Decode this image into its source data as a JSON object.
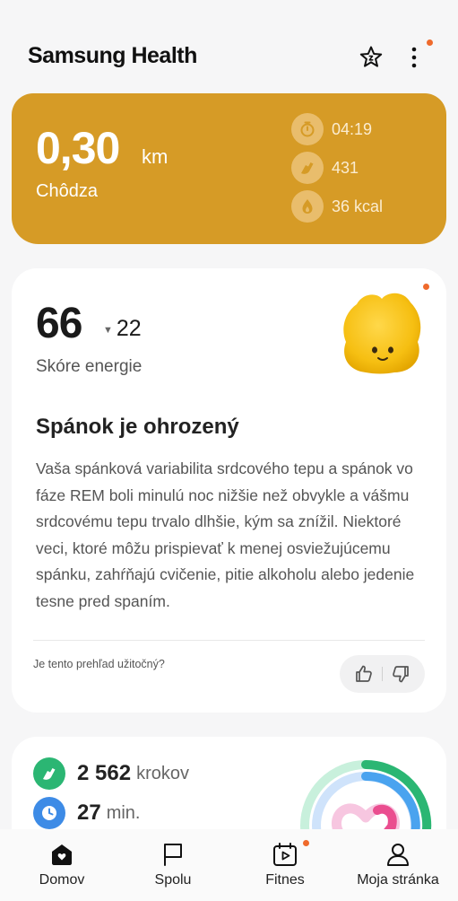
{
  "header": {
    "title": "Samsung Health",
    "star_icon": "star-icon",
    "more_icon": "more-vertical-icon"
  },
  "walk": {
    "distance": "0,30",
    "unit": "km",
    "activity": "Chôdza",
    "stats": [
      {
        "icon": "timer-icon",
        "value": "04:19"
      },
      {
        "icon": "shoe-icon",
        "value": "431"
      },
      {
        "icon": "flame-icon",
        "value": "36 kcal"
      }
    ],
    "color": "#d69b26"
  },
  "energy": {
    "score": "66",
    "delta": "22",
    "label": "Skóre energie",
    "insight_title": "Spánok je ohrozený",
    "insight_body": "Vaša spánková variabilita srdcového tepu a spánok vo fáze REM boli minulú noc nižšie než obvykle a vášmu srdcovému tepu trvalo dlhšie, kým sa znížil. Niektoré veci, ktoré môžu prispievať k menej osviežujúcemu spánku, zahŕňajú cvičenie, pitie alkoholu alebo jedenie tesne pred spaním.",
    "feedback_question": "Je tento prehľad užitočný?"
  },
  "activity": {
    "steps_value": "2 562",
    "steps_unit": "krokov",
    "minutes_value": "27",
    "minutes_unit": "min."
  },
  "nav": {
    "items": [
      {
        "label": "Domov",
        "icon": "home-icon"
      },
      {
        "label": "Spolu",
        "icon": "flag-icon"
      },
      {
        "label": "Fitnes",
        "icon": "video-calendar-icon"
      },
      {
        "label": "Moja stránka",
        "icon": "person-icon"
      }
    ]
  },
  "colors": {
    "accent_orange": "#ef6a2c",
    "step_green": "#2bb673",
    "time_blue": "#3d8be6"
  }
}
